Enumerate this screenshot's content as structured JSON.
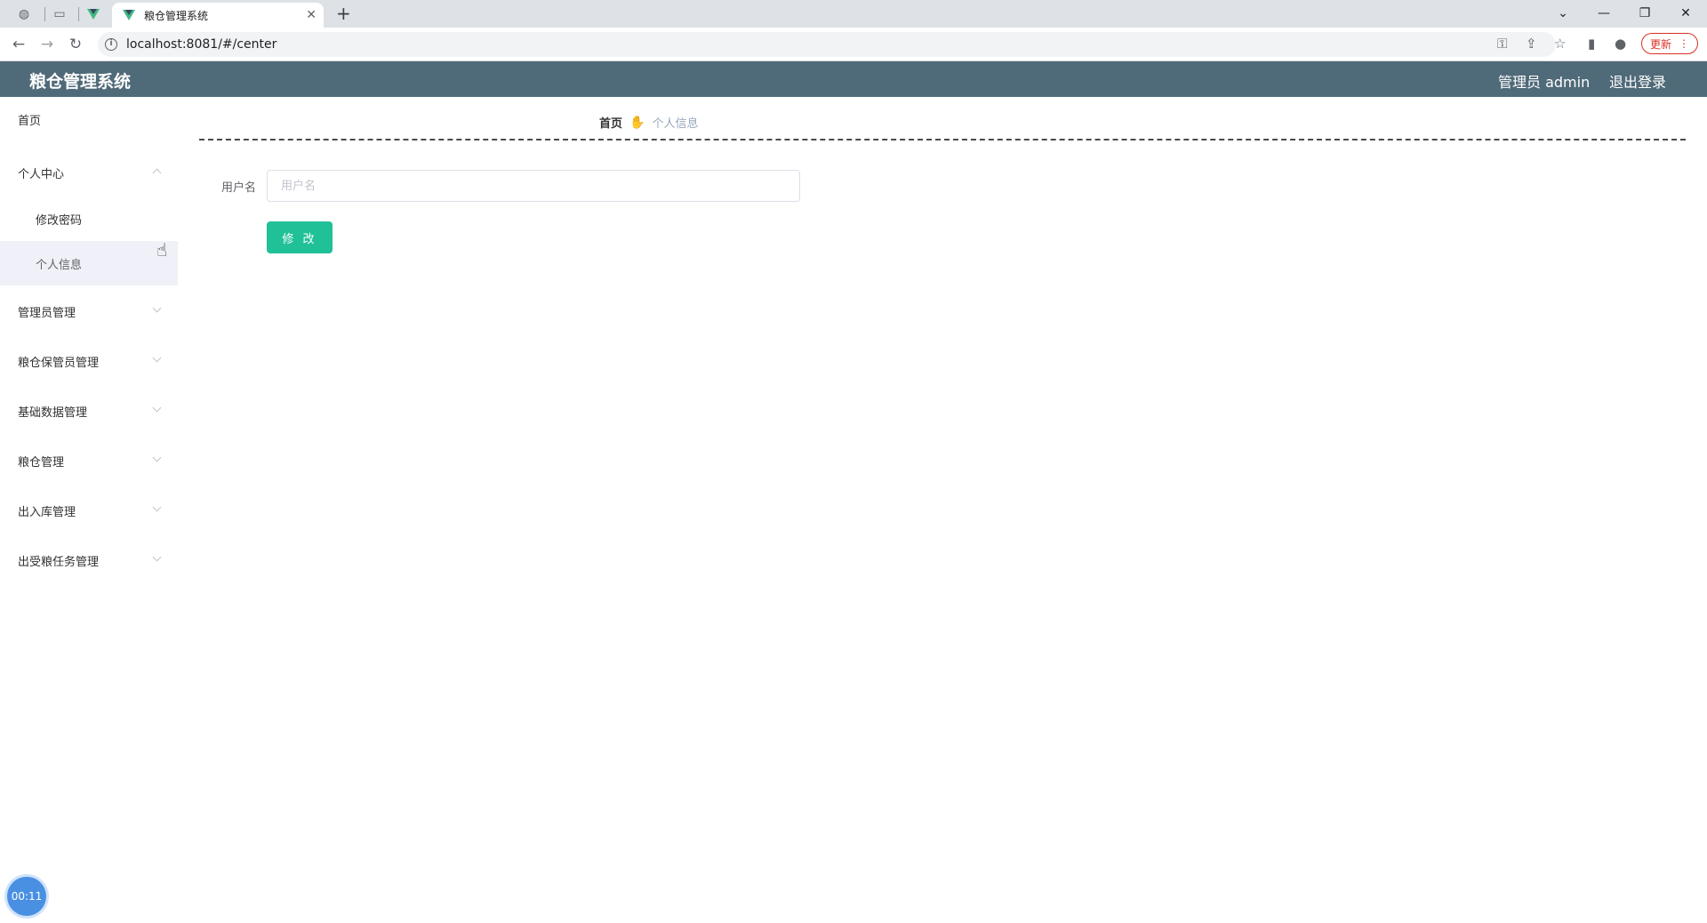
{
  "browser": {
    "tab_title": "粮仓管理系统",
    "tab_close": "✕",
    "new_tab": "+",
    "url": "localhost:8081/#/center",
    "update_label": "更新"
  },
  "header": {
    "title": "粮仓管理系统",
    "user": "管理员 admin",
    "logout": "退出登录"
  },
  "sidebar": {
    "home": "首页",
    "personal_center": "个人中心",
    "change_password": "修改密码",
    "personal_info": "个人信息",
    "items": [
      "管理员管理",
      "粮仓保管员管理",
      "基础数据管理",
      "粮仓管理",
      "出入库管理",
      "出受粮任务管理"
    ]
  },
  "breadcrumb": {
    "home": "首页",
    "separator_icon": "hand-icon",
    "current": "个人信息"
  },
  "form": {
    "username_label": "用户名",
    "username_value": "",
    "username_placeholder": "用户名",
    "submit_label": "修 改"
  },
  "timer": "00:11",
  "colors": {
    "header_bg": "#4f6a78",
    "button_bg": "#20c197",
    "active_submenu_bg": "#f0f0f8"
  }
}
